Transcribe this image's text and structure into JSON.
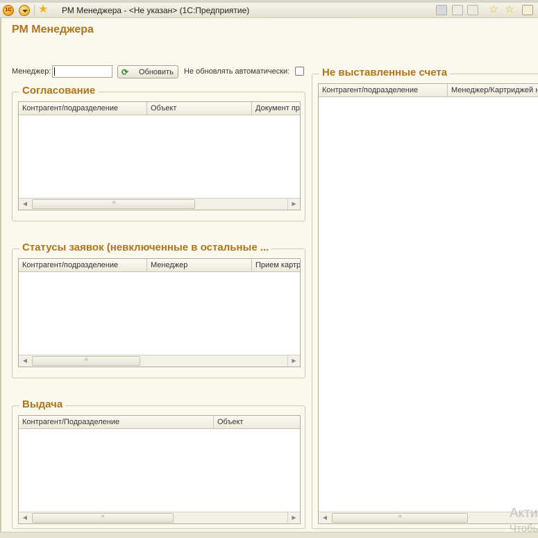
{
  "window": {
    "title": "РМ Менеджера -  <Не указан>  (1С:Предприятие)",
    "behind_text": "..."
  },
  "page_title": "РМ Менеджера",
  "filter": {
    "manager_label": "Менеджер:",
    "manager_value": "",
    "select_label": "...",
    "clear_label": "×",
    "refresh_label": "Обновить",
    "no_auto_label": "Не обновлять автоматически:",
    "no_auto_checked": false
  },
  "groups": {
    "approval": {
      "title": "Согласование",
      "columns": [
        "Контрагент/подразделение",
        "Объект",
        "Документ пр"
      ],
      "rows": []
    },
    "statuses": {
      "title": "Статусы заявок (невключенные в остальные ...",
      "columns": [
        "Контрагент/подразделение",
        "Менеджер",
        "Прием картр"
      ],
      "rows": []
    },
    "issue": {
      "title": "Выдача",
      "columns": [
        "Контрагент/Подразделение",
        "Объект"
      ],
      "rows": []
    },
    "invoices": {
      "title": "Не выставленные счета",
      "columns": [
        "Контрагент/подразделение",
        "Менеджер/Картриджей н"
      ],
      "rows": []
    }
  },
  "watermark": {
    "line1": "Акти",
    "line2": "Чтобы"
  }
}
